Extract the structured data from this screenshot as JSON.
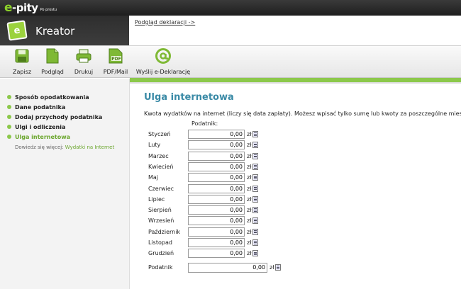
{
  "logo": {
    "e": "e",
    "rest": "-pity",
    "tagline": "Po prostu"
  },
  "kreator": {
    "icon_letter": "e",
    "title": "Kreator"
  },
  "preview_link": "Podgląd deklaracji ->",
  "toolbar": {
    "save": "Zapisz",
    "preview": "Podgląd",
    "print": "Drukuj",
    "pdf": "PDF/Mail",
    "send": "Wyślij e-Deklarację",
    "pdf_icon_text": "PDF"
  },
  "sidebar": {
    "steps": [
      {
        "label": "Sposób opodatkowania"
      },
      {
        "label": "Dane podatnika"
      },
      {
        "label": "Dodaj przychody podatnika"
      },
      {
        "label": "Ulgi i odliczenia"
      },
      {
        "label": "Ulga internetowa",
        "active": true
      }
    ],
    "more_prefix": "Dowiedz się więcej:",
    "more_link": "Wydatki na Internet"
  },
  "main": {
    "title": "Ulga internetowa",
    "description": "Kwota wydatków na internet (liczy się data zapłaty). Możesz wpisać tylko sumę lub kwoty za poszczególne miesiące.",
    "column_header": "Podatnik:",
    "unit": "zł",
    "months": [
      {
        "label": "Styczeń",
        "value": "0,00"
      },
      {
        "label": "Luty",
        "value": "0,00"
      },
      {
        "label": "Marzec",
        "value": "0,00"
      },
      {
        "label": "Kwiecień",
        "value": "0,00"
      },
      {
        "label": "Maj",
        "value": "0,00"
      },
      {
        "label": "Czerwiec",
        "value": "0,00"
      },
      {
        "label": "Lipiec",
        "value": "0,00"
      },
      {
        "label": "Sierpień",
        "value": "0,00"
      },
      {
        "label": "Wrzesień",
        "value": "0,00"
      },
      {
        "label": "Październik",
        "value": "0,00"
      },
      {
        "label": "Listopad",
        "value": "0,00"
      },
      {
        "label": "Grudzień",
        "value": "0,00"
      }
    ],
    "total": {
      "label": "Podatnik",
      "value": "0,00"
    }
  },
  "colors": {
    "accent_green": "#8cc84b",
    "title_blue": "#3a8aa6"
  }
}
